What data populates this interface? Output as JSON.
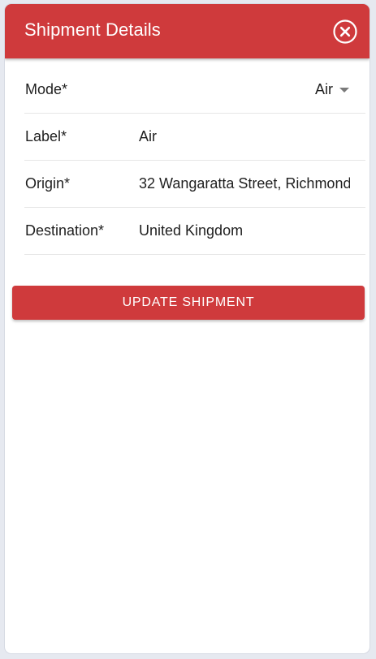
{
  "header": {
    "title": "Shipment Details",
    "close_icon": "close-circle-icon"
  },
  "form": {
    "mode": {
      "label": "Mode*",
      "value": "Air"
    },
    "label": {
      "label": "Label*",
      "value": "Air"
    },
    "origin": {
      "label": "Origin*",
      "value": "32 Wangaratta Street, Richmond"
    },
    "destination": {
      "label": "Destination*",
      "value": "United Kingdom"
    }
  },
  "actions": {
    "update_label": "UPDATE SHIPMENT"
  },
  "colors": {
    "brand": "#cf3a3c",
    "background": "#e6e9f0"
  }
}
